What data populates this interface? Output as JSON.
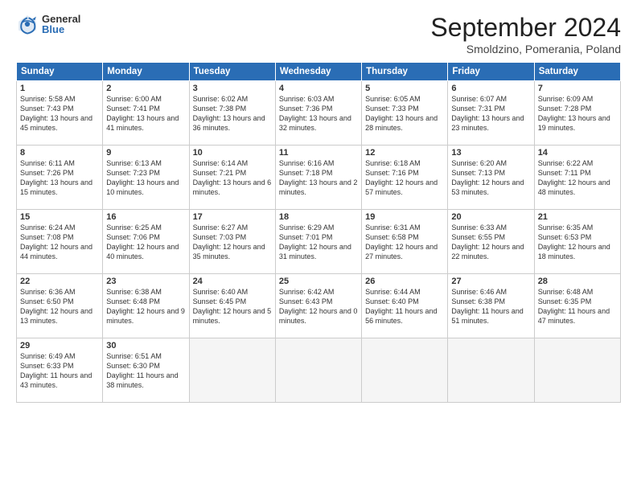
{
  "logo": {
    "general": "General",
    "blue": "Blue"
  },
  "title": "September 2024",
  "subtitle": "Smoldzino, Pomerania, Poland",
  "headers": [
    "Sunday",
    "Monday",
    "Tuesday",
    "Wednesday",
    "Thursday",
    "Friday",
    "Saturday"
  ],
  "weeks": [
    [
      {
        "day": "1",
        "sunrise": "Sunrise: 5:58 AM",
        "sunset": "Sunset: 7:43 PM",
        "daylight": "Daylight: 13 hours and 45 minutes."
      },
      {
        "day": "2",
        "sunrise": "Sunrise: 6:00 AM",
        "sunset": "Sunset: 7:41 PM",
        "daylight": "Daylight: 13 hours and 41 minutes."
      },
      {
        "day": "3",
        "sunrise": "Sunrise: 6:02 AM",
        "sunset": "Sunset: 7:38 PM",
        "daylight": "Daylight: 13 hours and 36 minutes."
      },
      {
        "day": "4",
        "sunrise": "Sunrise: 6:03 AM",
        "sunset": "Sunset: 7:36 PM",
        "daylight": "Daylight: 13 hours and 32 minutes."
      },
      {
        "day": "5",
        "sunrise": "Sunrise: 6:05 AM",
        "sunset": "Sunset: 7:33 PM",
        "daylight": "Daylight: 13 hours and 28 minutes."
      },
      {
        "day": "6",
        "sunrise": "Sunrise: 6:07 AM",
        "sunset": "Sunset: 7:31 PM",
        "daylight": "Daylight: 13 hours and 23 minutes."
      },
      {
        "day": "7",
        "sunrise": "Sunrise: 6:09 AM",
        "sunset": "Sunset: 7:28 PM",
        "daylight": "Daylight: 13 hours and 19 minutes."
      }
    ],
    [
      {
        "day": "8",
        "sunrise": "Sunrise: 6:11 AM",
        "sunset": "Sunset: 7:26 PM",
        "daylight": "Daylight: 13 hours and 15 minutes."
      },
      {
        "day": "9",
        "sunrise": "Sunrise: 6:13 AM",
        "sunset": "Sunset: 7:23 PM",
        "daylight": "Daylight: 13 hours and 10 minutes."
      },
      {
        "day": "10",
        "sunrise": "Sunrise: 6:14 AM",
        "sunset": "Sunset: 7:21 PM",
        "daylight": "Daylight: 13 hours and 6 minutes."
      },
      {
        "day": "11",
        "sunrise": "Sunrise: 6:16 AM",
        "sunset": "Sunset: 7:18 PM",
        "daylight": "Daylight: 13 hours and 2 minutes."
      },
      {
        "day": "12",
        "sunrise": "Sunrise: 6:18 AM",
        "sunset": "Sunset: 7:16 PM",
        "daylight": "Daylight: 12 hours and 57 minutes."
      },
      {
        "day": "13",
        "sunrise": "Sunrise: 6:20 AM",
        "sunset": "Sunset: 7:13 PM",
        "daylight": "Daylight: 12 hours and 53 minutes."
      },
      {
        "day": "14",
        "sunrise": "Sunrise: 6:22 AM",
        "sunset": "Sunset: 7:11 PM",
        "daylight": "Daylight: 12 hours and 48 minutes."
      }
    ],
    [
      {
        "day": "15",
        "sunrise": "Sunrise: 6:24 AM",
        "sunset": "Sunset: 7:08 PM",
        "daylight": "Daylight: 12 hours and 44 minutes."
      },
      {
        "day": "16",
        "sunrise": "Sunrise: 6:25 AM",
        "sunset": "Sunset: 7:06 PM",
        "daylight": "Daylight: 12 hours and 40 minutes."
      },
      {
        "day": "17",
        "sunrise": "Sunrise: 6:27 AM",
        "sunset": "Sunset: 7:03 PM",
        "daylight": "Daylight: 12 hours and 35 minutes."
      },
      {
        "day": "18",
        "sunrise": "Sunrise: 6:29 AM",
        "sunset": "Sunset: 7:01 PM",
        "daylight": "Daylight: 12 hours and 31 minutes."
      },
      {
        "day": "19",
        "sunrise": "Sunrise: 6:31 AM",
        "sunset": "Sunset: 6:58 PM",
        "daylight": "Daylight: 12 hours and 27 minutes."
      },
      {
        "day": "20",
        "sunrise": "Sunrise: 6:33 AM",
        "sunset": "Sunset: 6:55 PM",
        "daylight": "Daylight: 12 hours and 22 minutes."
      },
      {
        "day": "21",
        "sunrise": "Sunrise: 6:35 AM",
        "sunset": "Sunset: 6:53 PM",
        "daylight": "Daylight: 12 hours and 18 minutes."
      }
    ],
    [
      {
        "day": "22",
        "sunrise": "Sunrise: 6:36 AM",
        "sunset": "Sunset: 6:50 PM",
        "daylight": "Daylight: 12 hours and 13 minutes."
      },
      {
        "day": "23",
        "sunrise": "Sunrise: 6:38 AM",
        "sunset": "Sunset: 6:48 PM",
        "daylight": "Daylight: 12 hours and 9 minutes."
      },
      {
        "day": "24",
        "sunrise": "Sunrise: 6:40 AM",
        "sunset": "Sunset: 6:45 PM",
        "daylight": "Daylight: 12 hours and 5 minutes."
      },
      {
        "day": "25",
        "sunrise": "Sunrise: 6:42 AM",
        "sunset": "Sunset: 6:43 PM",
        "daylight": "Daylight: 12 hours and 0 minutes."
      },
      {
        "day": "26",
        "sunrise": "Sunrise: 6:44 AM",
        "sunset": "Sunset: 6:40 PM",
        "daylight": "Daylight: 11 hours and 56 minutes."
      },
      {
        "day": "27",
        "sunrise": "Sunrise: 6:46 AM",
        "sunset": "Sunset: 6:38 PM",
        "daylight": "Daylight: 11 hours and 51 minutes."
      },
      {
        "day": "28",
        "sunrise": "Sunrise: 6:48 AM",
        "sunset": "Sunset: 6:35 PM",
        "daylight": "Daylight: 11 hours and 47 minutes."
      }
    ],
    [
      {
        "day": "29",
        "sunrise": "Sunrise: 6:49 AM",
        "sunset": "Sunset: 6:33 PM",
        "daylight": "Daylight: 11 hours and 43 minutes."
      },
      {
        "day": "30",
        "sunrise": "Sunrise: 6:51 AM",
        "sunset": "Sunset: 6:30 PM",
        "daylight": "Daylight: 11 hours and 38 minutes."
      },
      null,
      null,
      null,
      null,
      null
    ]
  ]
}
